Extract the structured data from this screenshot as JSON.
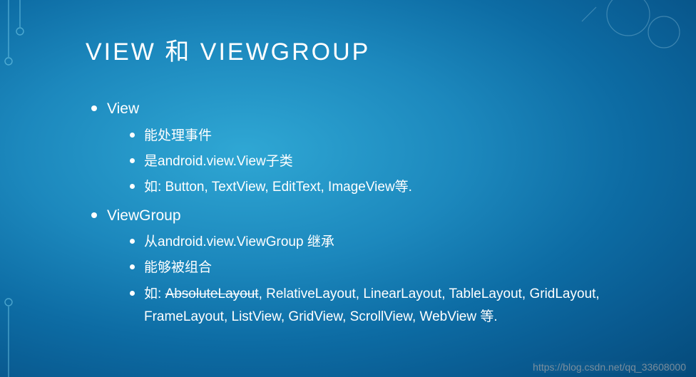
{
  "title": "VIEW 和 VIEWGROUP",
  "sections": [
    {
      "heading": "View",
      "items": [
        "能处理事件",
        "是android.view.View子类",
        "如: Button, TextView, EditText, ImageView等."
      ]
    },
    {
      "heading": "ViewGroup",
      "items": [
        "从android.view.ViewGroup 继承",
        "能够被组合",
        {
          "prefix": "如: ",
          "strike": "AbsoluteLayout",
          "rest": ", RelativeLayout, LinearLayout, TableLayout, GridLayout, FrameLayout, ListView, GridView, ScrollView, WebView 等."
        }
      ]
    }
  ],
  "watermark": "https://blog.csdn.net/qq_33608000"
}
